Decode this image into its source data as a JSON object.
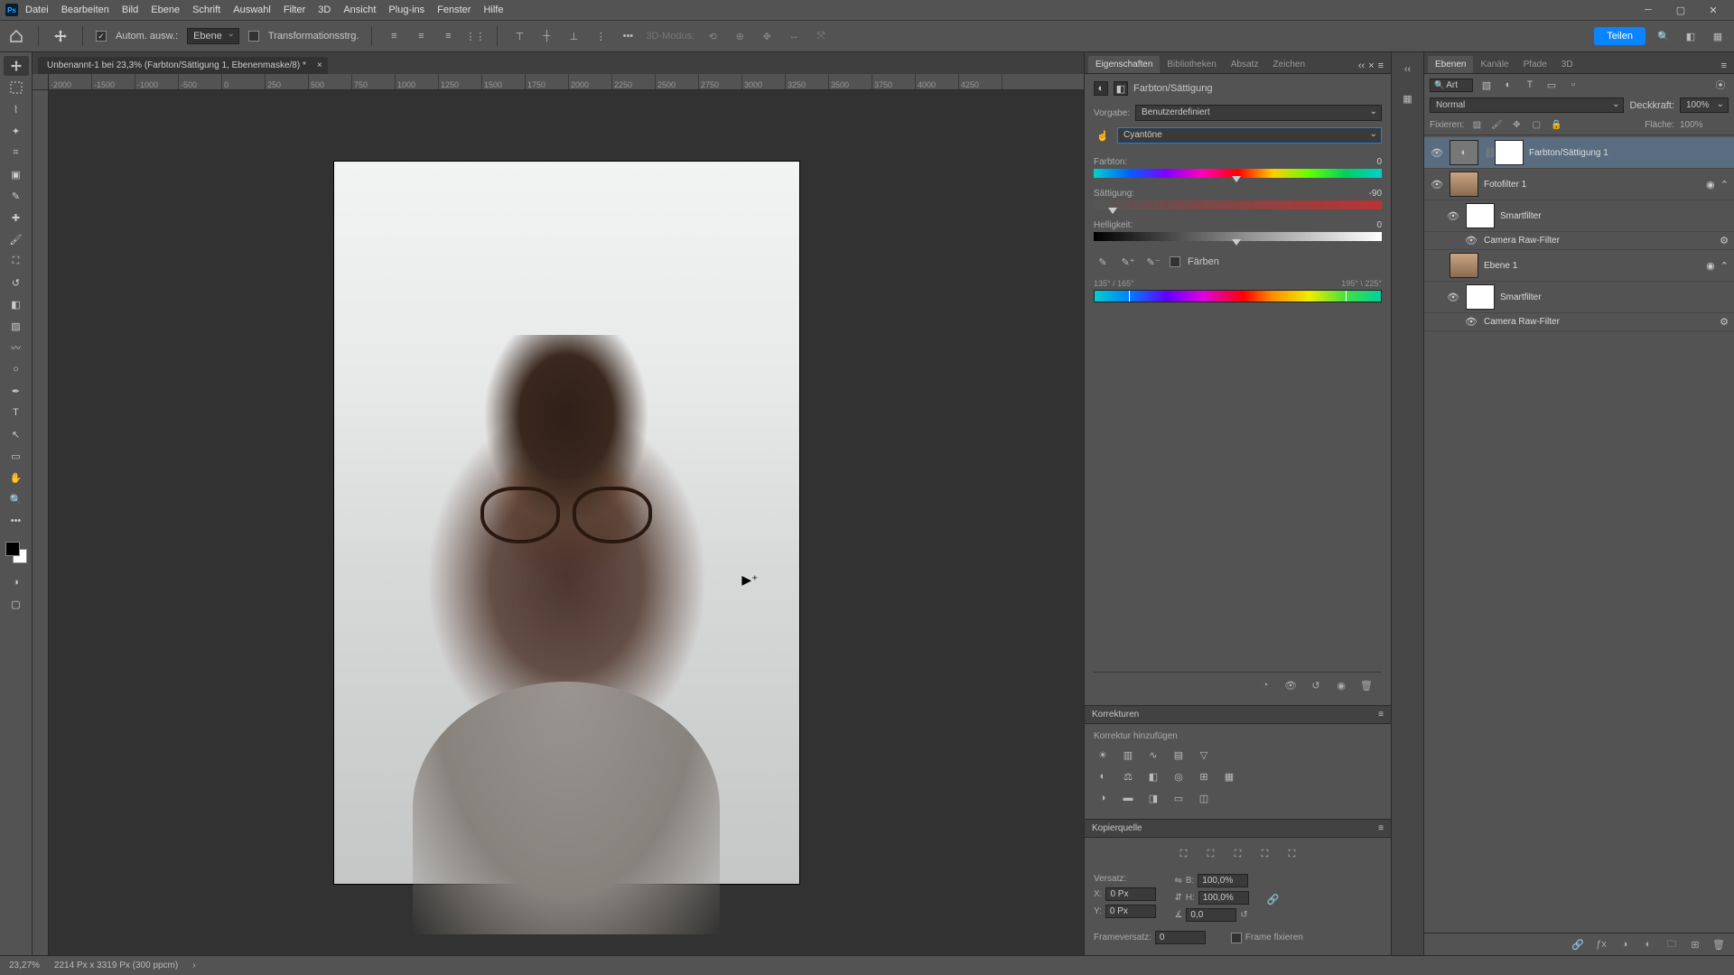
{
  "menu": {
    "datei": "Datei",
    "bearbeiten": "Bearbeiten",
    "bild": "Bild",
    "ebene": "Ebene",
    "schrift": "Schrift",
    "auswahl": "Auswahl",
    "filter": "Filter",
    "d3": "3D",
    "ansicht": "Ansicht",
    "plugins": "Plug-ins",
    "fenster": "Fenster",
    "hilfe": "Hilfe"
  },
  "options": {
    "auto_ausw": "Autom. ausw.:",
    "ebene": "Ebene",
    "transform": "Transformationsstrg.",
    "d3_modus": "3D-Modus:",
    "share": "Teilen"
  },
  "doc_tab": "Unbenannt-1 bei 23,3% (Farbton/Sättigung 1, Ebenenmaske/8) *",
  "ruler_h": [
    "-2000",
    "-1500",
    "-1000",
    "-500",
    "0",
    "250",
    "500",
    "750",
    "1000",
    "1250",
    "1500",
    "1750",
    "2000",
    "2250",
    "2500",
    "2750",
    "3000",
    "3250",
    "3500",
    "3750",
    "4000",
    "4250"
  ],
  "panel_tabs": {
    "eigenschaften": "Eigenschaften",
    "bibliotheken": "Bibliotheken",
    "absatz": "Absatz",
    "zeichen": "Zeichen"
  },
  "properties": {
    "title": "Farbton/Sättigung",
    "vorgabe_label": "Vorgabe:",
    "vorgabe_value": "Benutzerdefiniert",
    "channel_value": "Cyantöne",
    "farbton_label": "Farbton:",
    "farbton_val": "0",
    "saett_label": "Sättigung:",
    "saett_val": "-90",
    "hell_label": "Helligkeit:",
    "hell_val": "0",
    "faerben": "Färben",
    "range_left": "135° / 165°",
    "range_right": "195° \\ 225°"
  },
  "korrekturen": {
    "title": "Korrekturen",
    "hint": "Korrektur hinzufügen"
  },
  "kopierquelle": {
    "title": "Kopierquelle",
    "versatz": "Versatz:",
    "x_label": "X:",
    "x_val": "0 Px",
    "y_label": "Y:",
    "y_val": "0 Px",
    "w_label": "B:",
    "w_val": "100,0%",
    "h_label": "H:",
    "h_val": "100,0%",
    "angle": "0,0",
    "frame_label": "Frameversatz:",
    "frame_val": "0",
    "frame_fix": "Frame fixieren"
  },
  "layers": {
    "tabs": {
      "ebenen": "Ebenen",
      "kanaele": "Kanäle",
      "pfade": "Pfade",
      "d3": "3D"
    },
    "filter_type": "Art",
    "blend_label_mode": "Normal",
    "deckkraft_label": "Deckkraft:",
    "deckkraft_val": "100%",
    "fixieren": "Fixieren:",
    "flaeche_label": "Fläche:",
    "flaeche_val": "100%",
    "items": [
      {
        "name": "Farbton/Sättigung 1"
      },
      {
        "name": "Fotofilter 1"
      },
      {
        "name": "Smartfilter"
      },
      {
        "name": "Camera Raw-Filter"
      },
      {
        "name": "Ebene 1"
      },
      {
        "name": "Smartfilter"
      },
      {
        "name": "Camera Raw-Filter"
      }
    ]
  },
  "status": {
    "zoom": "23,27%",
    "info": "2214 Px x 3319 Px (300 ppcm)"
  }
}
